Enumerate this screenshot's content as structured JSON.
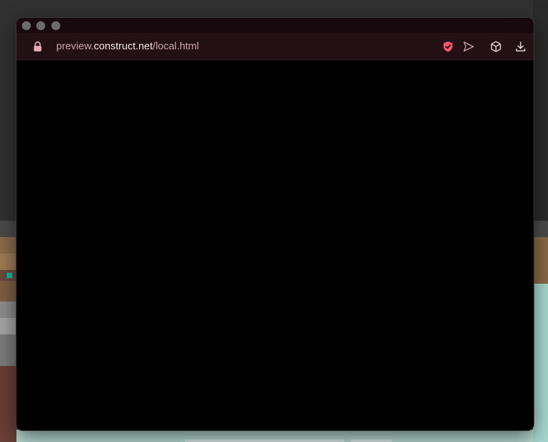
{
  "window": {
    "address_bar": {
      "url_prefix": "preview.",
      "url_host": "construct.net",
      "url_path": "/local.html",
      "icons": [
        "lock-icon",
        "shield-check-icon",
        "send-icon",
        "cube-icon",
        "download-icon"
      ]
    },
    "viewport": {
      "background": "#000000"
    }
  },
  "colors": {
    "accent": "#ff5470",
    "titlebar": "#17090d",
    "address_bar": "#231015",
    "url_text": "#c9a6ae",
    "url_host_text": "#f1e7ea"
  }
}
